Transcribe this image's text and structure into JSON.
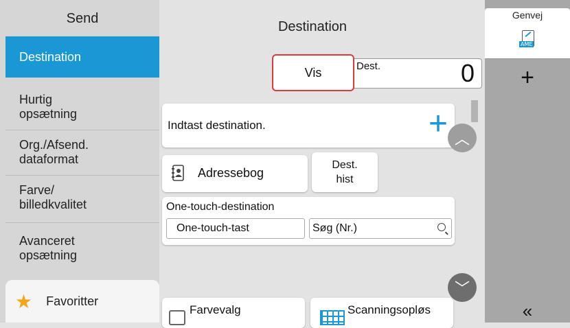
{
  "sidebar": {
    "title": "Send",
    "items": [
      {
        "label": "Destination"
      },
      {
        "label": "Hurtig\nopsætning"
      },
      {
        "label": "Org./Afsend.\ndataformat"
      },
      {
        "label": "Farve/\nbilledkvalitet"
      },
      {
        "label": "Avanceret\nopsætning"
      }
    ],
    "favorites_label": "Favoritter"
  },
  "main": {
    "title": "Destination",
    "vis_label": "Vis",
    "dest_label": "Dest.",
    "dest_count": "0",
    "input_label": "Indtast destination.",
    "addressbook_label": "Adressebog",
    "dest_hist_label": "Dest.\nhist",
    "onetouch": {
      "title": "One-touch-destination",
      "key_label": "One-touch-tast",
      "search_label": "Søg (Nr.)"
    },
    "bottom": {
      "color_label": "Farvevalg",
      "scan_label": "Scanningsopløs"
    }
  },
  "right": {
    "tab_label": "Genvej",
    "icon_tag": "AME"
  },
  "colors": {
    "accent": "#1a98d5",
    "highlight": "#e0393b",
    "star": "#f3a61a"
  },
  "icons": [
    "star-icon",
    "plus-icon",
    "addressbook-icon",
    "magnifier-icon",
    "chevron-up-icon",
    "chevron-down-icon",
    "double-chevron-left-icon",
    "shortcut-document-icon",
    "color-select-icon",
    "scan-resolution-icon"
  ]
}
